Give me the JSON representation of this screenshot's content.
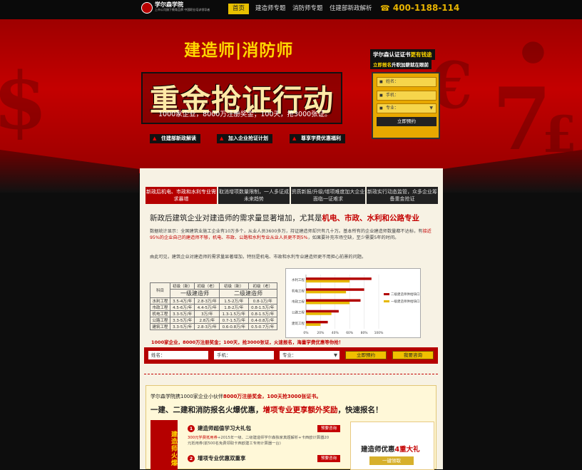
{
  "logo": {
    "name": "学尔森学院",
    "sub": "上市公司旗下教育品牌 中国职业培训领导者"
  },
  "nav": {
    "items": [
      {
        "label": "首页",
        "active": true
      },
      {
        "label": "建造师专题"
      },
      {
        "label": "消防师专题"
      },
      {
        "label": "住建部新政解析"
      }
    ],
    "phone": "400-1188-114"
  },
  "hero": {
    "subtitle": "建造师|消防师",
    "title": "重金抢证行动",
    "desc": "1000家企业，8000万注册奖金；100天，抢3000张证。",
    "buttons": [
      "住建部新政解读",
      "加入企业抢证计划",
      "尊享学费优惠福利"
    ]
  },
  "form_card": {
    "line1_a": "学尔森认证证书",
    "line1_b": "更有钱途",
    "line2_a": "立即报名",
    "line2_b": "升职加薪就在眼前",
    "name_ph": "姓名：",
    "phone_ph": "手机：",
    "major_ph": "专业：",
    "submit": "立即预约"
  },
  "tabs": [
    {
      "label": "新政后机电、市政和水利专业需求暴增"
    },
    {
      "label": "取消增项数量限制，一人多证成未来趋势"
    },
    {
      "label": "资质新报/升级/增项难度加大企业面临一证难求"
    },
    {
      "label": "新政实行动态监管，众多企业筹备重金抢证"
    }
  ],
  "section": {
    "title_a": "新政后建筑企业对建造师的需求量显著增加，尤其是",
    "title_b": "机电、市政、水利和公路专业",
    "p1_a": "数据统计显示：全国建筑业施工企业有10万多个，从业人员3600多万，持证建造师却只有几十万。基本所有的企业建造师数量都不达标，有",
    "p1_b": "接近95%的企业自己的建造师不够，机电、市政、公路和水利专业从业人员更不到5%",
    "p1_c": "，如果要补充市场空缺，至少需要5年的时间。",
    "p2": "由此可见，建筑企业对建造师的需求量显著增加，特别是机电、市政和水利专业建造师更不用担心前景的问题。"
  },
  "table": {
    "h_sub": [
      "科目",
      "初级（新）",
      "初级（老）",
      "初级（新）",
      "初级（老）"
    ],
    "group1": "一级建造师",
    "group2": "二级建造师",
    "rows": [
      [
        "水利工程",
        "3.5-4万/年",
        "2.8-3万/年",
        "1.5-2万/年",
        "0.8-1万/年"
      ],
      [
        "市政工程",
        "4.5-6万/年",
        "4.4-5万/年",
        "1.8-2万/年",
        "0.8-1.5万/年"
      ],
      [
        "机电工程",
        "3.3-5万/年",
        "3万/年",
        "1.3-1.5万/年",
        "0.8-1.5万/年"
      ],
      [
        "公路工程",
        "3.3-5万/年",
        "2.8万/年",
        "0.7-1.5万/年",
        "0.4-0.8万/年"
      ],
      [
        "建筑工程",
        "3.3-5万/年",
        "2.8-3万/年",
        "0.6-0.8万/年",
        "0.5-0.7万/年"
      ]
    ]
  },
  "chart_data": {
    "type": "bar",
    "categories": [
      "水利工程",
      "机电工程",
      "市政工程",
      "公路工程",
      "建筑工程"
    ],
    "series": [
      {
        "name": "二级建造师供给缺口",
        "values": [
          90,
          80,
          75,
          45,
          30
        ]
      },
      {
        "name": "一级建造师供给缺口",
        "values": [
          60,
          55,
          60,
          35,
          20
        ]
      }
    ],
    "xticks": [
      "0%",
      "20%",
      "40%",
      "60%",
      "80%",
      "100%"
    ],
    "xlim": [
      0,
      100
    ],
    "colors": [
      "#b20000",
      "#e6b800"
    ]
  },
  "promo_line": "1000家企业，8000万注册奖金；100天，抢3000张证，火速报名，海量学费优惠等你抢！",
  "bottom_form": {
    "name": "姓名：",
    "phone": "手机：",
    "major": "专业：",
    "submit": "立即预约",
    "consult": "我要咨询"
  },
  "promo": {
    "line1_a": "学尔森学院携1000家企业小伙伴",
    "line1_b": "8000万注册奖金，100天抢3000张证书。",
    "line2_a": "一建、二建和消防报名火爆优惠，",
    "line2_b": "增项专业更享额外奖励",
    "line2_c": "，快速报名！",
    "vertical": "建造师火爆",
    "item1_title": "建造师超值学习大礼包",
    "item1_btn": "预要咨询",
    "item1_desc_a": "300元学费抵用券",
    "item1_desc_b": "+2015年一级、二级建造师学尔森独家真题解析+卡西欧计算器20元抵用券(前500名免费领取卡西欧建工专用计算器一台)",
    "item2_title": "增项专业优惠双重享",
    "item2_btn": "预要咨询",
    "gift_title_a": "建造师优惠",
    "gift_title_b": "4重大礼",
    "gift_btn": "一键领取"
  }
}
